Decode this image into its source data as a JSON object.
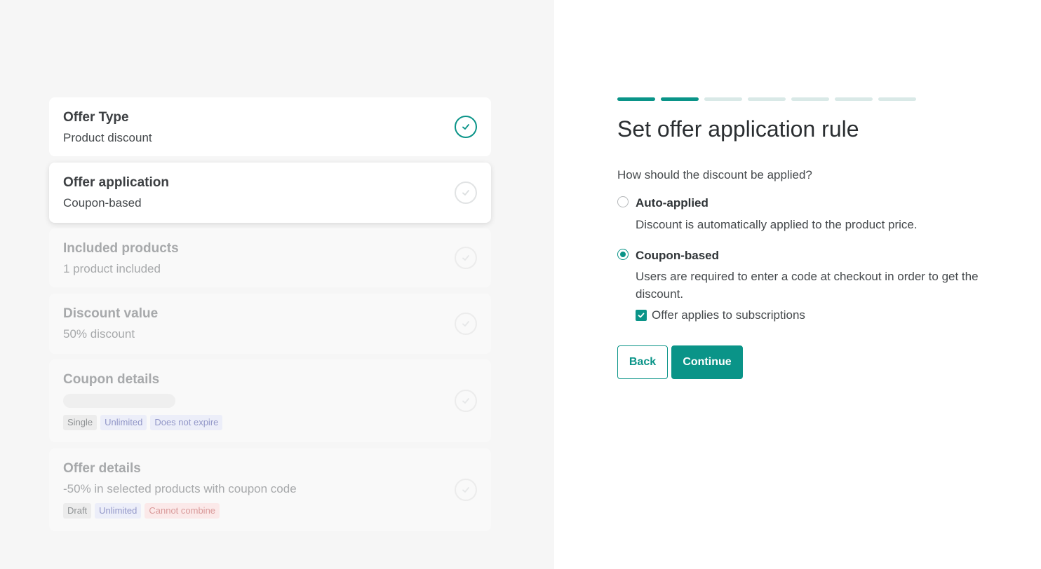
{
  "steps": [
    {
      "title": "Offer Type",
      "subtitle": "Product discount",
      "state": "done"
    },
    {
      "title": "Offer application",
      "subtitle": "Coupon-based",
      "state": "active"
    },
    {
      "title": "Included products",
      "subtitle": "1 product included",
      "state": "pending"
    },
    {
      "title": "Discount value",
      "subtitle": "50% discount",
      "state": "pending"
    },
    {
      "title": "Coupon details",
      "subtitle": "",
      "state": "pending",
      "tags": [
        "Single",
        "Unlimited",
        "Does not expire"
      ]
    },
    {
      "title": "Offer details",
      "subtitle": "-50% in selected products with coupon code",
      "state": "pending",
      "tags": [
        "Draft",
        "Unlimited",
        "Cannot combine"
      ]
    }
  ],
  "progress": {
    "total": 7,
    "completed": 2
  },
  "form": {
    "heading": "Set offer application rule",
    "question": "How should the discount be applied?",
    "options": [
      {
        "label": "Auto-applied",
        "description": "Discount is automatically applied to the product price.",
        "selected": false
      },
      {
        "label": "Coupon-based",
        "description": "Users are required to enter a code at checkout in order to get the discount.",
        "selected": true
      }
    ],
    "subscription_checkbox": {
      "label": "Offer applies to subscriptions",
      "checked": true
    },
    "back_label": "Back",
    "continue_label": "Continue"
  },
  "colors": {
    "accent": "#0a9488",
    "left_bg": "#f6f6f6"
  }
}
